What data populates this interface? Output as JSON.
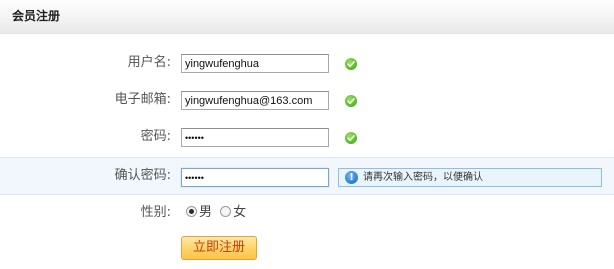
{
  "header": {
    "title": "会员注册"
  },
  "form": {
    "username": {
      "label": "用户名:",
      "value": "yingwufenghua",
      "status": "valid"
    },
    "email": {
      "label": "电子邮箱:",
      "value": "yingwufenghua@163.com",
      "status": "valid"
    },
    "password": {
      "label": "密码:",
      "value": "••••••",
      "status": "valid"
    },
    "confirm_password": {
      "label": "确认密码:",
      "value": "••••••",
      "hint": "请再次输入密码，以便确认",
      "hint_icon": "info-icon"
    },
    "gender": {
      "label": "性别:",
      "options": [
        {
          "label": "男",
          "checked": true
        },
        {
          "label": "女",
          "checked": false
        }
      ]
    },
    "submit_label": "立即注册"
  },
  "colors": {
    "valid": "#5fbf2a",
    "hint_border": "#8cc0e8",
    "hint_bg": "#eaf4fc",
    "button": "#fbc44b",
    "button_text": "#c2410c"
  }
}
